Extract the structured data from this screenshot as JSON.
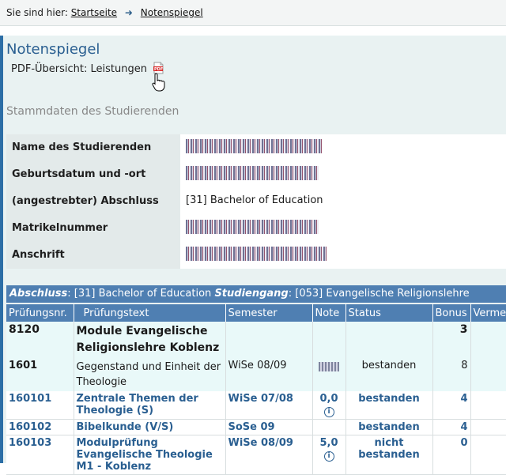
{
  "breadcrumb": {
    "prefix": "Sie sind hier:",
    "home": "Startseite",
    "current": "Notenspiegel"
  },
  "page": {
    "title": "Notenspiegel",
    "pdf_label": "PDF-Übersicht: Leistungen",
    "stammdaten_heading": "Stammdaten des Studierenden"
  },
  "stammdaten": [
    {
      "label": "Name des Studierenden",
      "value": ""
    },
    {
      "label": "Geburtsdatum und -ort",
      "value": ""
    },
    {
      "label": "(angestrebter) Abschluss",
      "value": "[31] Bachelor of Education"
    },
    {
      "label": "Matrikelnummer",
      "value": ""
    },
    {
      "label": "Anschrift",
      "value": ""
    }
  ],
  "abschluss_bar": {
    "abschluss_label": "Abschluss",
    "abschluss_value": ": [31] Bachelor of Education ",
    "studiengang_label": "Studiengang",
    "studiengang_value": ": [053] Evangelische Religionslehre"
  },
  "table": {
    "headers": [
      "Prüfungsnr.",
      "Prüfungstext",
      "Semester",
      "Note",
      "Status",
      "Bonus",
      "Vermerk"
    ],
    "rows": [
      {
        "kind": "module",
        "nr": "8120",
        "text": "Module Evangelische Religionslehre Koblenz",
        "semester": "",
        "note": "",
        "status": "",
        "bonus": "3"
      },
      {
        "kind": "sub",
        "nr": "1601",
        "text": "Gegenstand und Einheit der Theologie",
        "semester": "WiSe 08/09",
        "note": "",
        "status": "bestanden",
        "bonus": "8"
      },
      {
        "kind": "exam",
        "nr": "160101",
        "text": "Zentrale Themen der Theologie (S)",
        "semester": "WiSe 07/08",
        "note": "0,0",
        "status": "bestanden",
        "bonus": "4"
      },
      {
        "kind": "exam",
        "nr": "160102",
        "text": "Bibelkunde (V/S)",
        "semester": "SoSe 09",
        "note": "",
        "status": "bestanden",
        "bonus": "4"
      },
      {
        "kind": "exam",
        "nr": "160103",
        "text": "Modulprüfung Evangelische Theologie M1 - Koblenz",
        "semester": "WiSe 08/09",
        "note": "5,0",
        "status": "nicht bestanden",
        "bonus": "0"
      }
    ]
  },
  "icons": {
    "pdf": "pdf-file-icon",
    "cursor": "hand-cursor-icon",
    "info": "info-icon",
    "arrow": "arrow-right-icon"
  },
  "colors": {
    "accent": "#2c6ea6",
    "header_bg": "#4f7fb2",
    "link": "#2a5f91"
  }
}
